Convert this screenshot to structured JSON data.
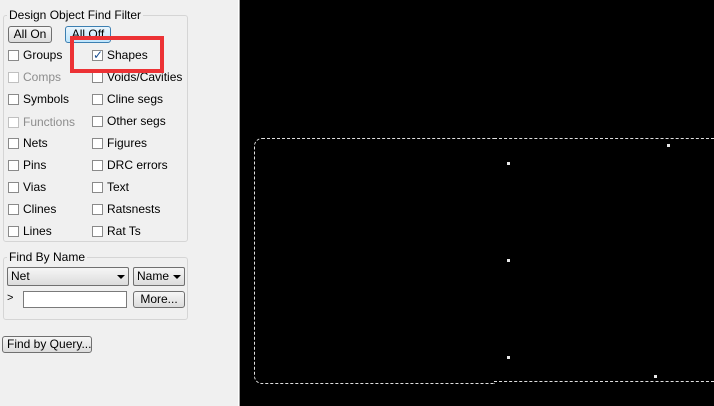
{
  "find_filter": {
    "title": "Design Object Find Filter",
    "all_on_label": "All On",
    "all_off_label": "All Off",
    "objects": [
      {
        "label": "Groups",
        "checked": false,
        "enabled": true
      },
      {
        "label": "Shapes",
        "checked": true,
        "enabled": true
      },
      {
        "label": "Comps",
        "checked": false,
        "enabled": false
      },
      {
        "label": "Voids/Cavities",
        "checked": false,
        "enabled": true
      },
      {
        "label": "Symbols",
        "checked": false,
        "enabled": true
      },
      {
        "label": "Cline segs",
        "checked": false,
        "enabled": true
      },
      {
        "label": "Functions",
        "checked": false,
        "enabled": false
      },
      {
        "label": "Other segs",
        "checked": false,
        "enabled": true
      },
      {
        "label": "Nets",
        "checked": false,
        "enabled": true
      },
      {
        "label": "Figures",
        "checked": false,
        "enabled": true
      },
      {
        "label": "Pins",
        "checked": false,
        "enabled": true
      },
      {
        "label": "DRC errors",
        "checked": false,
        "enabled": true
      },
      {
        "label": "Vias",
        "checked": false,
        "enabled": true
      },
      {
        "label": "Text",
        "checked": false,
        "enabled": true
      },
      {
        "label": "Clines",
        "checked": false,
        "enabled": true
      },
      {
        "label": "Ratsnests",
        "checked": false,
        "enabled": true
      },
      {
        "label": "Lines",
        "checked": false,
        "enabled": true
      },
      {
        "label": "Rat Ts",
        "checked": false,
        "enabled": true
      }
    ]
  },
  "find_by_name": {
    "title": "Find By Name",
    "type_value": "Net",
    "mode_value": "Name",
    "prompt_marker": ">",
    "name_value": "",
    "more_label": "More..."
  },
  "find_by_query_label": "Find by Query...",
  "highlight_color": "#ec3235",
  "canvas_color": "#000000"
}
